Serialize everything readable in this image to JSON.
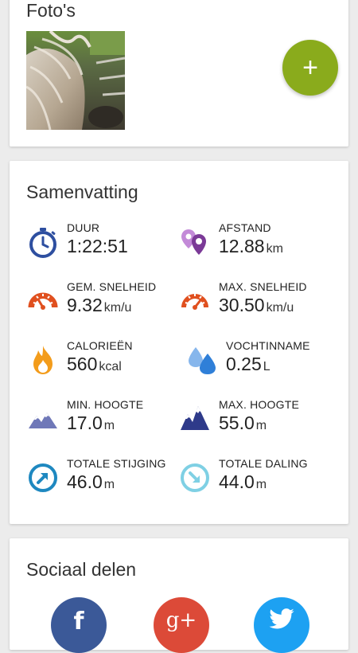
{
  "photos": {
    "title": "Foto's",
    "add_label": "+",
    "colors": {
      "fab": "#8aab1c"
    }
  },
  "summary": {
    "title": "Samenvatting",
    "stats": [
      {
        "label": "DUUR",
        "value": "1:22:51",
        "unit": "",
        "icon": "stopwatch-icon",
        "color": "#2e4fa0"
      },
      {
        "label": "AFSTAND",
        "value": "12.88",
        "unit": "km",
        "icon": "map-pins-icon",
        "color": "#7b3a97"
      },
      {
        "label": "GEM. SNELHEID",
        "value": "9.32",
        "unit": "km/u",
        "icon": "speedometer-icon",
        "color": "#e0501f"
      },
      {
        "label": "MAX. SNELHEID",
        "value": "30.50",
        "unit": "km/u",
        "icon": "speedometer-icon",
        "color": "#e0501f"
      },
      {
        "label": "CALORIEËN",
        "value": "560",
        "unit": "kcal",
        "icon": "flame-icon",
        "color": "#f39c1b"
      },
      {
        "label": "VOCHTINNAME",
        "value": "0.25",
        "unit": "L",
        "icon": "water-drops-icon",
        "color": "#2f7fd8"
      },
      {
        "label": "MIN. HOOGTE",
        "value": "17.0",
        "unit": "m",
        "icon": "mountain-low-icon",
        "color": "#6f78b8"
      },
      {
        "label": "MAX. HOOGTE",
        "value": "55.0",
        "unit": "m",
        "icon": "mountain-high-icon",
        "color": "#2e3a8a"
      },
      {
        "label": "TOTALE STIJGING",
        "value": "46.0",
        "unit": "m",
        "icon": "ascent-arrow-icon",
        "color": "#1e88c0"
      },
      {
        "label": "TOTALE DALING",
        "value": "44.0",
        "unit": "m",
        "icon": "descent-arrow-icon",
        "color": "#7fd0e4"
      }
    ]
  },
  "social": {
    "title": "Sociaal delen",
    "buttons": [
      {
        "name": "facebook",
        "glyph": "f",
        "color": "#3b5998"
      },
      {
        "name": "google-plus",
        "glyph": "g+",
        "color": "#dc4a38"
      },
      {
        "name": "twitter",
        "glyph": "",
        "color": "#1da1f2"
      }
    ]
  }
}
